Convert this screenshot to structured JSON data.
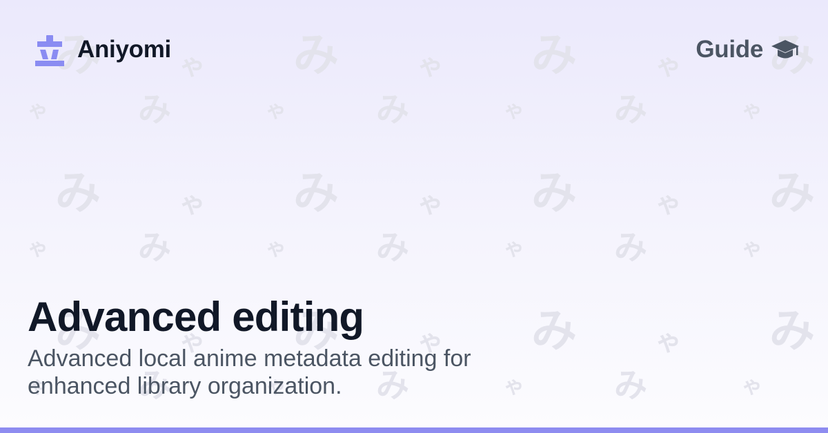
{
  "brand": {
    "name": "Aniyomi",
    "logo_icon": "aniyomi-logo-icon",
    "logo_color": "#8a8cf2"
  },
  "header": {
    "guide_label": "Guide",
    "guide_icon": "graduation-cap-icon"
  },
  "main": {
    "title": "Advanced editing",
    "subtitle": "Advanced local anime metadata editing for enhanced library organization."
  },
  "colors": {
    "accent": "#8e8cf0",
    "title_text": "#111827",
    "muted_text": "#4b5563",
    "pattern_glyph": "#e3e3ec",
    "background_top": "#ebe9fc",
    "background_bottom": "#fcfcfe"
  }
}
